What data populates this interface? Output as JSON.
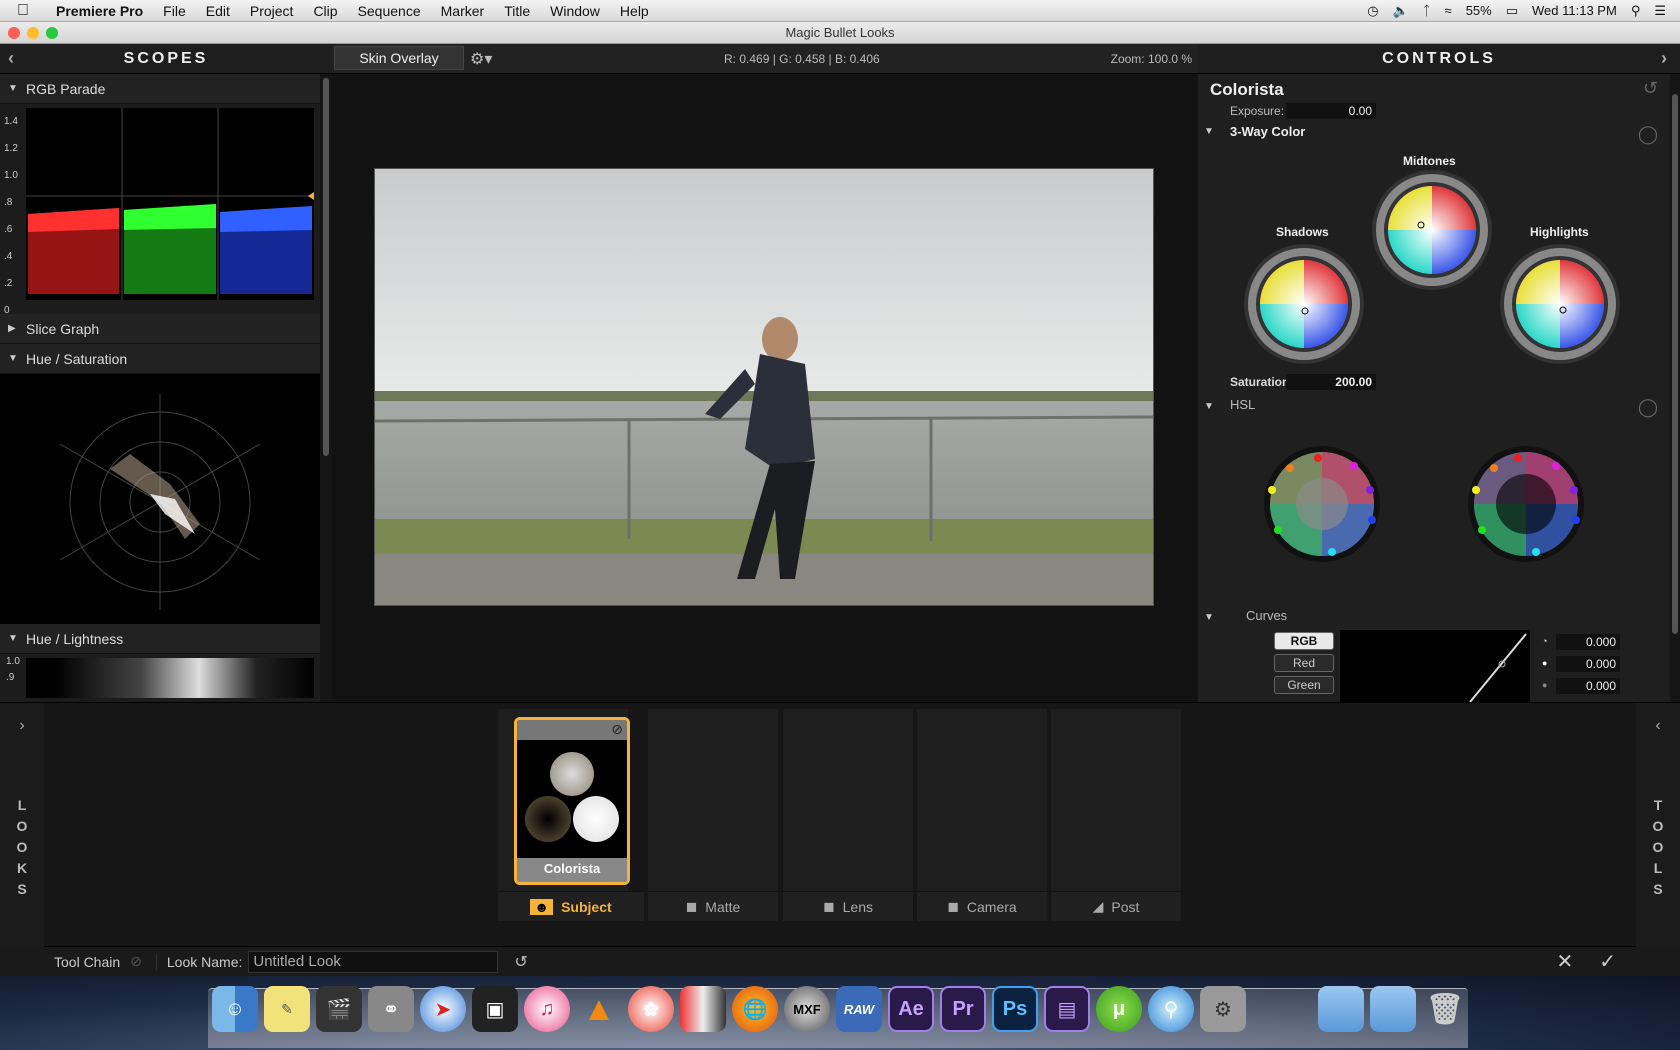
{
  "menubar": {
    "app": "Premiere Pro",
    "items": [
      "File",
      "Edit",
      "Project",
      "Clip",
      "Sequence",
      "Marker",
      "Title",
      "Window",
      "Help"
    ],
    "battery": "55%",
    "clock": "Wed 11:13 PM"
  },
  "window": {
    "title": "Magic Bullet Looks"
  },
  "scopes": {
    "title": "SCOPES",
    "rgb_parade": "RGB Parade",
    "parade_ticks": [
      "1.4",
      "1.2",
      "1.0",
      ".8",
      ".6",
      ".4",
      ".2",
      "0"
    ],
    "slice_graph": "Slice Graph",
    "hue_saturation": "Hue / Saturation",
    "hue_lightness": "Hue / Lightness",
    "hl_ticks": [
      "1.0",
      ".9"
    ]
  },
  "viewer": {
    "skin_overlay": "Skin Overlay",
    "readout": "R: 0.469 | G: 0.458 | B: 0.406",
    "zoom": "Zoom: 100.0 %"
  },
  "controls": {
    "title": "CONTROLS",
    "tool": "Colorista",
    "exposure_label": "Exposure:",
    "exposure_value": "0.00",
    "three_way": "3-Way Color",
    "midtones": "Midtones",
    "shadows": "Shadows",
    "highlights": "Highlights",
    "saturation_label": "Saturation:",
    "saturation_value": "200.00",
    "hsl": "HSL",
    "curves": "Curves",
    "curve_buttons": [
      "RGB",
      "Red",
      "Green"
    ],
    "curve_values": [
      "0.000",
      "0.000",
      "0.000"
    ]
  },
  "bottom": {
    "looks": [
      "L",
      "O",
      "O",
      "K",
      "S"
    ],
    "tools": [
      "T",
      "O",
      "O",
      "L",
      "S"
    ],
    "tool_card": "Colorista",
    "tabs": [
      "Subject",
      "Matte",
      "Lens",
      "Camera",
      "Post"
    ],
    "tool_chain": "Tool Chain",
    "look_name_label": "Look Name:",
    "look_name_value": "Untitled Look"
  },
  "dock": {
    "ae": "Ae",
    "pr": "Pr",
    "ps": "Ps",
    "mxf": "MXF",
    "raw": "RAW"
  },
  "colors": {
    "accent": "#f5b33a",
    "panel": "#1f1f1f"
  }
}
